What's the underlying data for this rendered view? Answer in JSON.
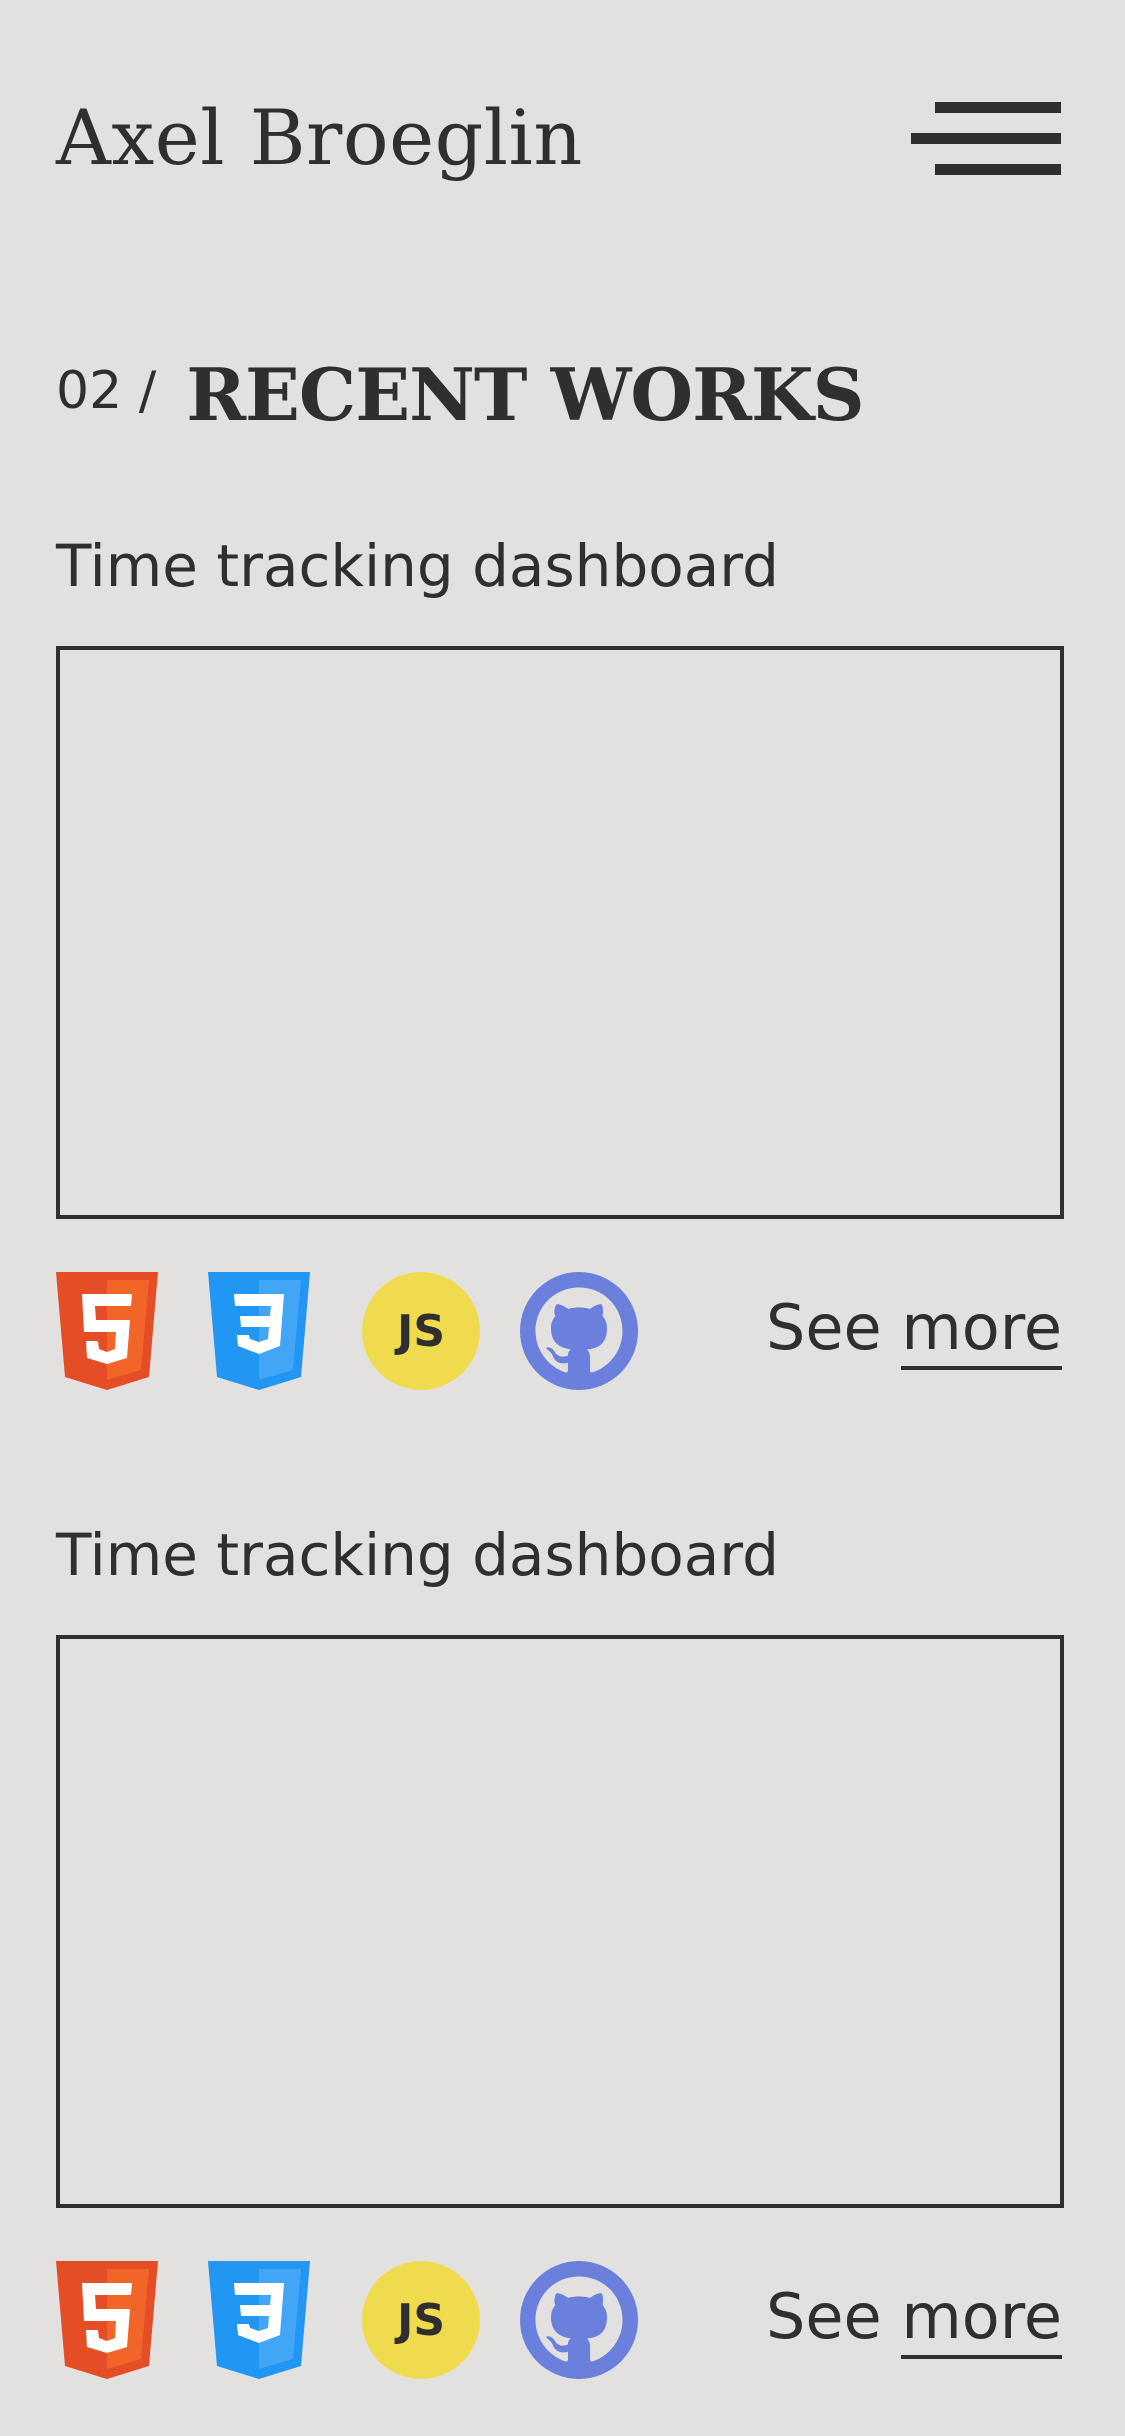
{
  "header": {
    "logo": "Axel Broeglin"
  },
  "section": {
    "number": "02 /",
    "title": "RECENT WORKS"
  },
  "projects": [
    {
      "title": "Time tracking dashboard",
      "see_label": "See",
      "more_label": "more",
      "tech": [
        "html5-icon",
        "css3-icon",
        "javascript-icon",
        "github-icon"
      ]
    },
    {
      "title": "Time tracking dashboard",
      "see_label": "See",
      "more_label": "more",
      "tech": [
        "html5-icon",
        "css3-icon",
        "javascript-icon",
        "github-icon"
      ]
    }
  ],
  "icons": {
    "js_text": "JS"
  },
  "colors": {
    "background": "#e2e1df",
    "text": "#2f2f2f",
    "html5": "#e44d26",
    "css3": "#2196f3",
    "javascript": "#f0db4f",
    "github": "#6b7fdc"
  }
}
